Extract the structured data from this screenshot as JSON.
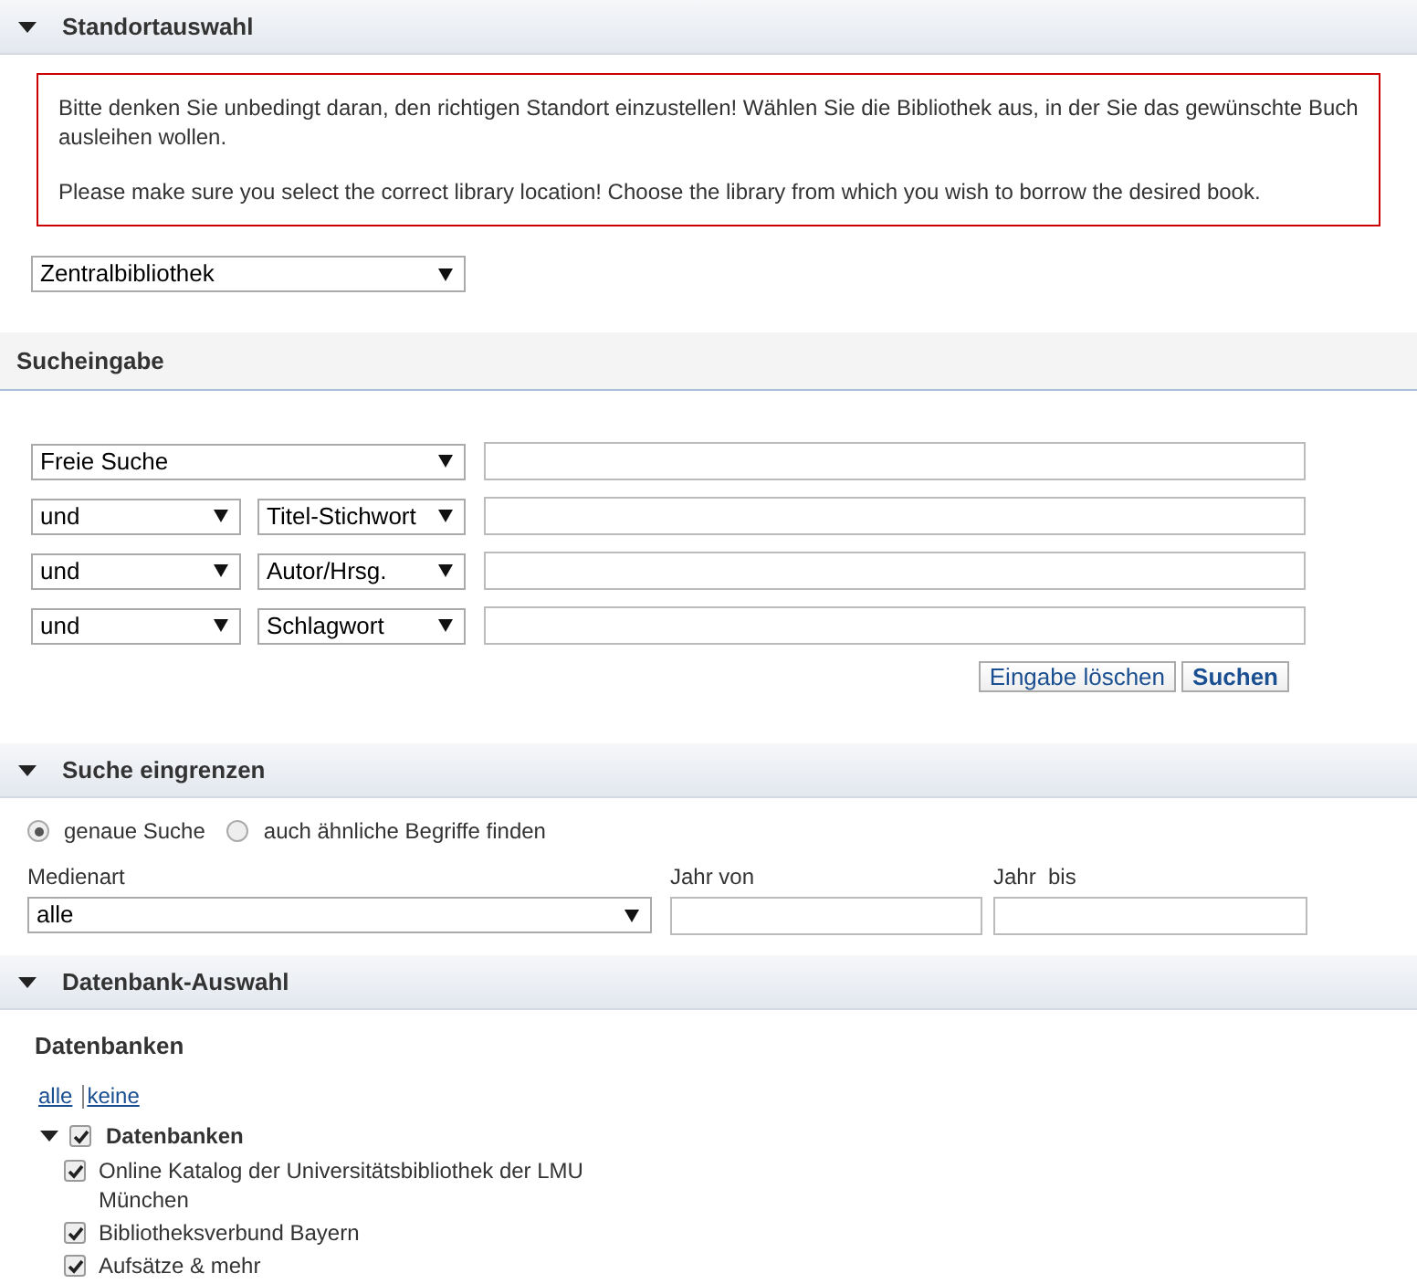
{
  "standort": {
    "title": "Standortauswahl",
    "expanded": true,
    "notice": [
      "Bitte denken Sie unbedingt daran, den richtigen Standort einzustellen! Wählen Sie die Bibliothek aus, in der Sie das gewünschte Buch ausleihen wollen.",
      "Please make sure you select the correct library location! Choose the library from which you wish to borrow the desired book."
    ],
    "location": "Zentralbibliothek"
  },
  "sucheingabe": {
    "title": "Sucheingabe",
    "rows": [
      {
        "kind": "first",
        "field": "Freie Suche"
      },
      {
        "kind": "combined",
        "operator": "und",
        "field": "Titel-Stichwort"
      },
      {
        "kind": "combined",
        "operator": "und",
        "field": "Autor/Hrsg."
      },
      {
        "kind": "combined",
        "operator": "und",
        "field": "Schlagwort"
      }
    ],
    "buttons": [
      {
        "label": "Eingabe löschen",
        "kind": "reset"
      },
      {
        "label": "Suchen",
        "kind": "submit"
      }
    ]
  },
  "eingrenzen": {
    "title": "Suche eingrenzen",
    "expanded": true,
    "options": [
      {
        "label": "genaue Suche",
        "selected": true
      },
      {
        "label": "auch ähnliche Begriffe finden",
        "selected": false
      }
    ],
    "medienart": {
      "label": "Medienart",
      "value": "alle"
    },
    "jahr_von": {
      "label": "Jahr von"
    },
    "jahr_bis": {
      "label": "Jahr  bis"
    }
  },
  "datenbank": {
    "title": "Datenbank-Auswahl",
    "expanded": true,
    "heading": "Datenbanken",
    "links": [
      "alle",
      "keine"
    ],
    "tree": {
      "label": "Datenbanken",
      "expanded": true,
      "checked": true,
      "children": [
        {
          "label": "Online Katalog der Universitätsbibliothek der LMU München",
          "checked": true
        },
        {
          "label": "Bibliotheksverbund Bayern",
          "checked": true
        },
        {
          "label": "Aufsätze & mehr",
          "checked": true
        }
      ]
    }
  }
}
